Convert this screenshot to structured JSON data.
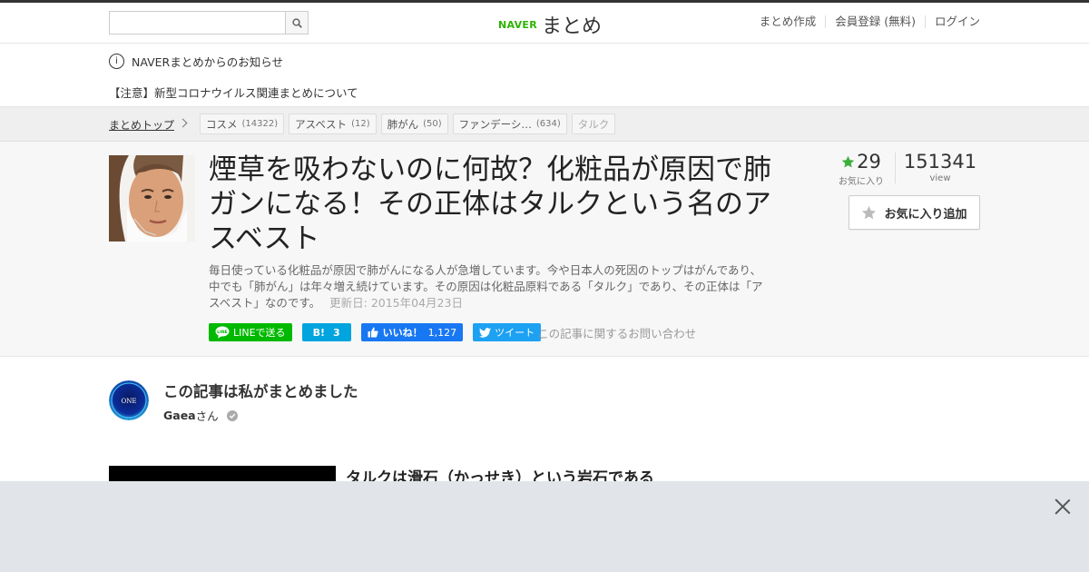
{
  "header": {
    "search_placeholder": "",
    "logo_brand": "NAVER",
    "logo_product": "まとめ",
    "nav": [
      "まとめ作成",
      "会員登録 (無料)",
      "ログイン"
    ]
  },
  "notice": {
    "title": "NAVERまとめからのお知らせ",
    "message": "【注意】新型コロナウイルス関連まとめについて"
  },
  "breadcrumb": {
    "top": "まとめトップ",
    "tags": [
      {
        "label": "コスメ",
        "count": "(14322)"
      },
      {
        "label": "アスベスト",
        "count": "(12)"
      },
      {
        "label": "肺がん",
        "count": "(50)"
      },
      {
        "label": "ファンデーシ…",
        "count": "(634)"
      },
      {
        "label": "タルク",
        "count": ""
      }
    ]
  },
  "article": {
    "title": "煙草を吸わないのに何故？化粧品が原因で肺ガンになる！その正体はタルクという名のアスベスト",
    "description": "毎日使っている化粧品が原因で肺がんになる人が急増しています。今や日本人の死因のトップはがんであり、中でも「肺がん」は年々増え続けています。その原因は化粧品原料である「タルク」であり、その正体は「アスベスト」なのです。",
    "updated": "更新日: 2015年04月23日",
    "share": {
      "line": "LINEで送る",
      "hatena_count": "3",
      "hatena_mark": "B!",
      "fb_like": "いいね！",
      "fb_count": "1,127",
      "tweet": "ツイート",
      "contact": "この記事に関するお問い合わせ"
    },
    "stats": {
      "favorites": "29",
      "favorites_label": "お気に入り",
      "views": "151341",
      "views_label": "view",
      "fav_button": "お気に入り追加"
    }
  },
  "author": {
    "heading": "この記事は私がまとめました",
    "name": "Gaea",
    "suffix": "さん",
    "avatar_text": "ONE"
  },
  "content": {
    "section_title": "タルクは滑石（かっせき）という岩石である"
  },
  "colors": {
    "naver_green": "#2db400",
    "line_green": "#00b900",
    "hatena_blue": "#00a4de",
    "facebook_blue": "#1877f2",
    "twitter_blue": "#1da1f2",
    "star_green": "#3cae3c"
  }
}
